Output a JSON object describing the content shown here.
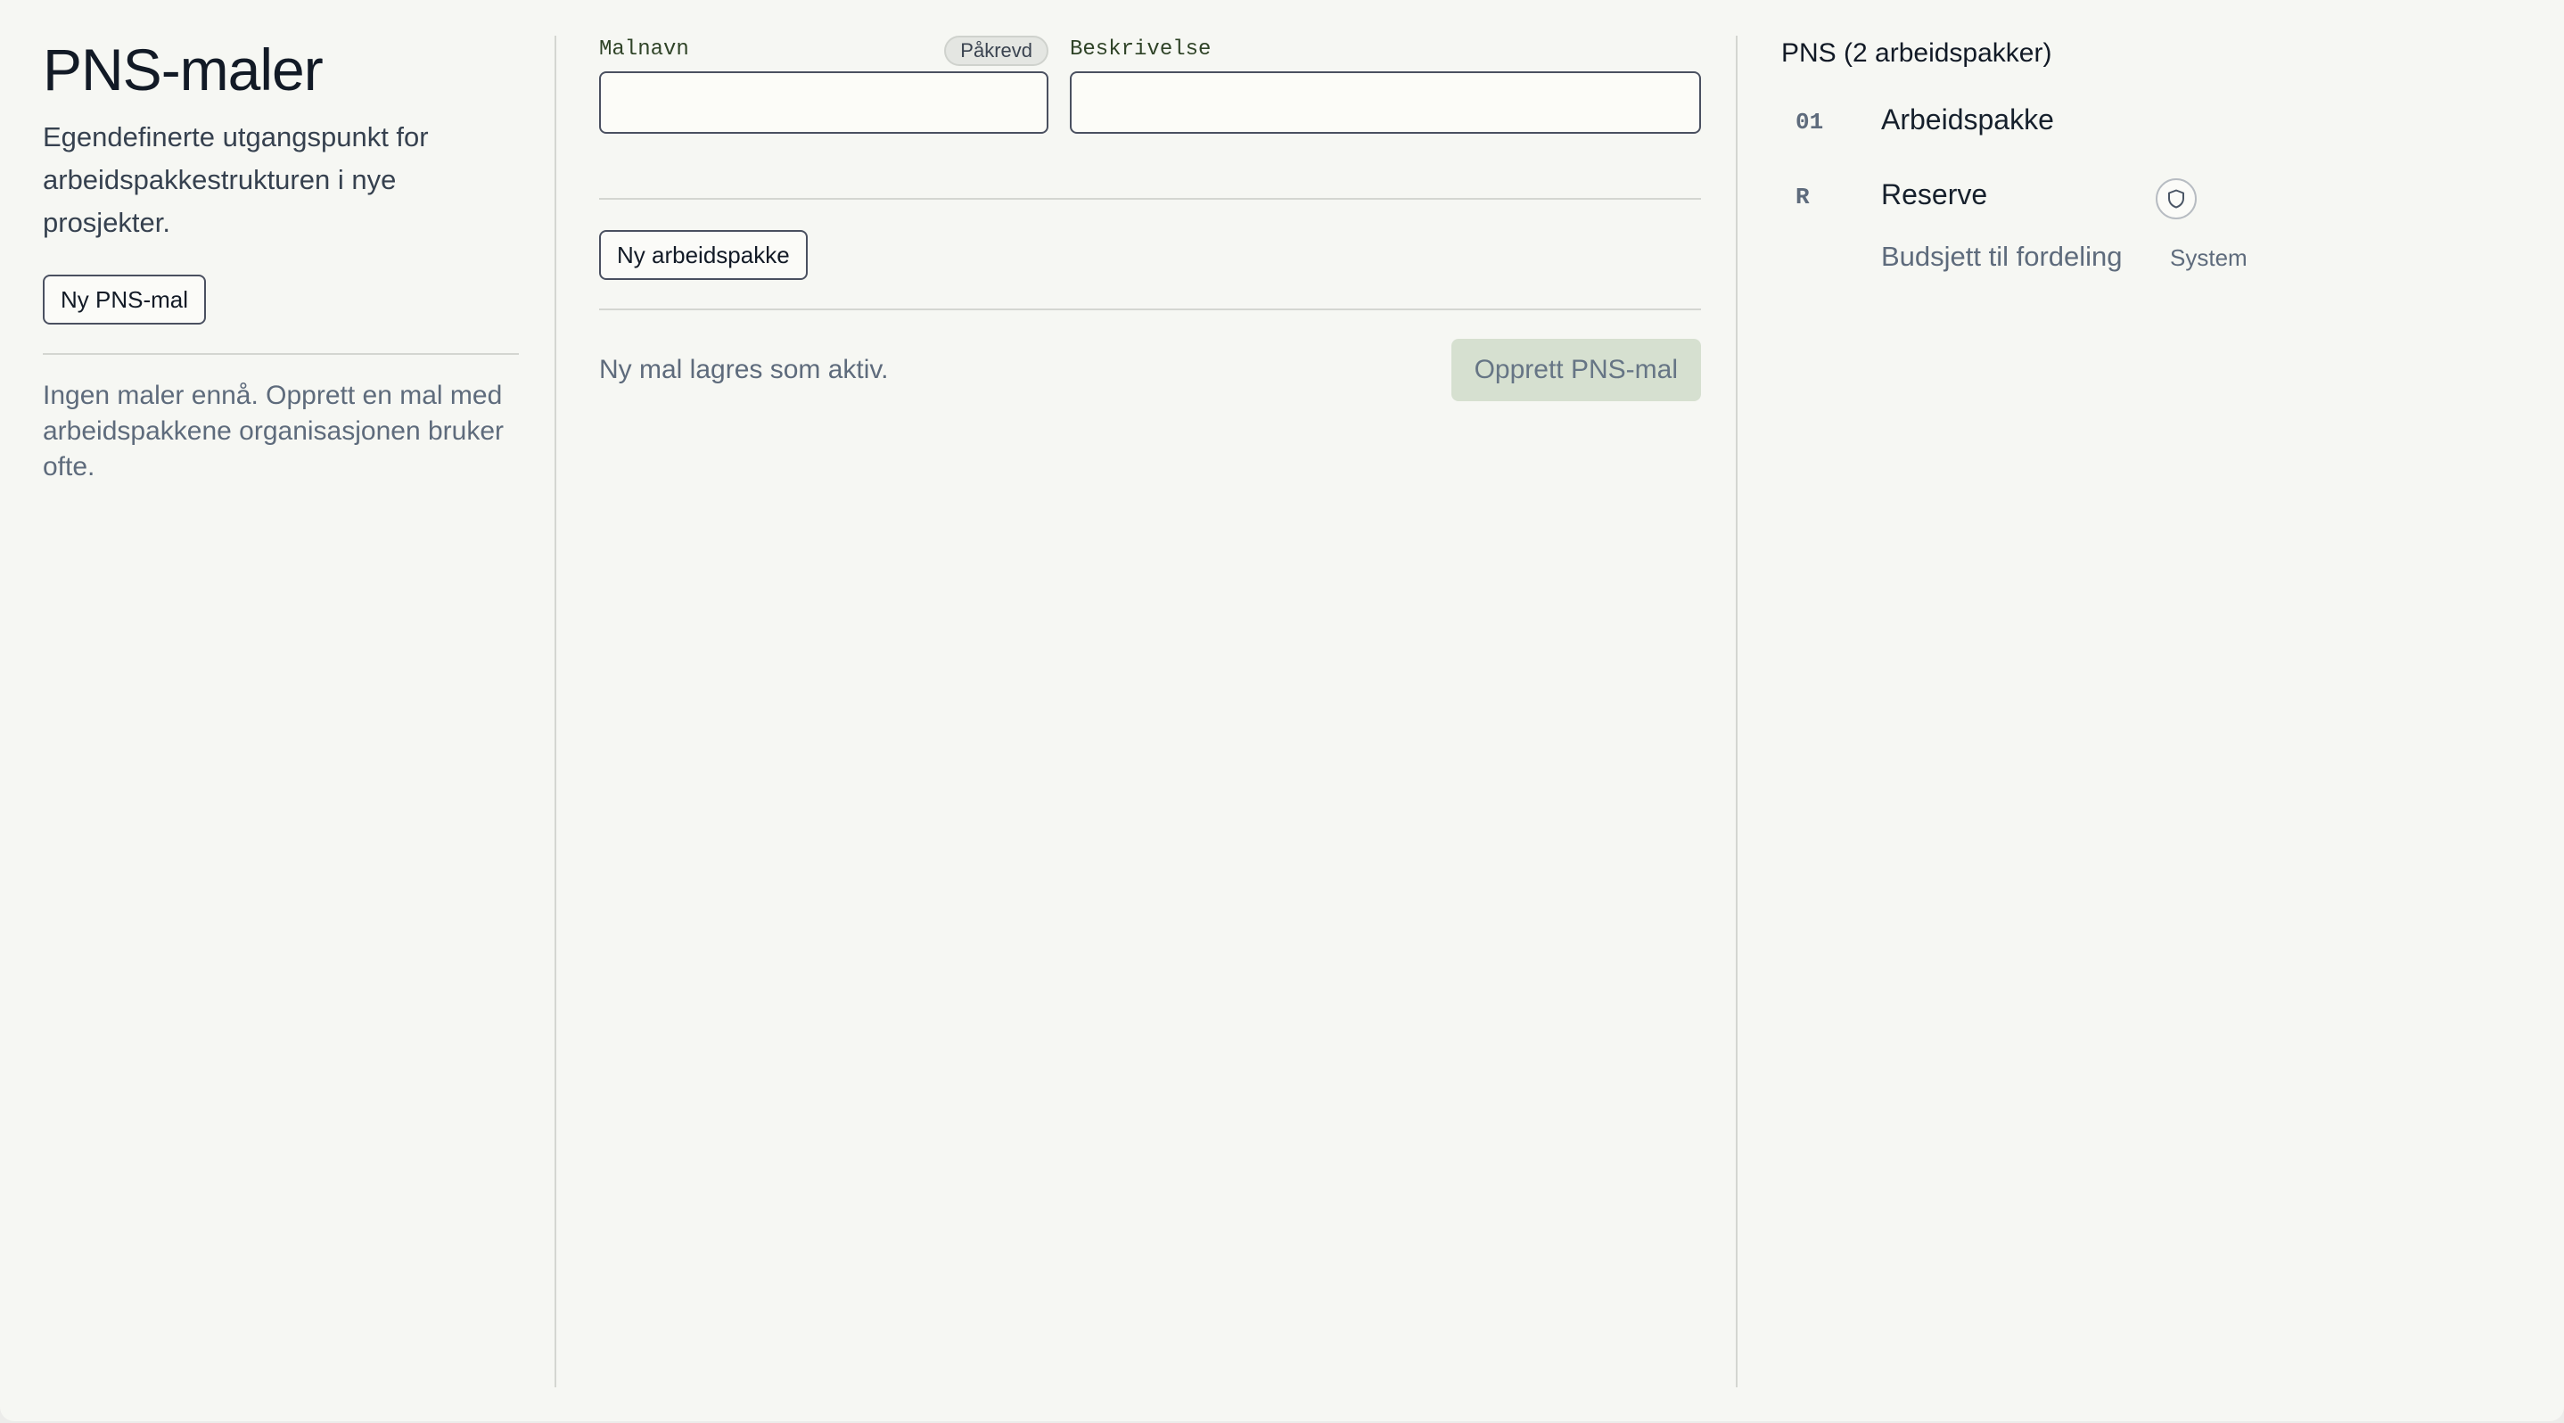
{
  "left": {
    "title": "PNS-maler",
    "subtitle": "Egendefinerte utgangspunkt for arbeidspakkestrukturen i nye prosjekter.",
    "new_template_label": "Ny PNS-mal",
    "empty_text": "Ingen maler ennå. Opprett en mal med arbeidspakkene organisasjonen bruker ofte."
  },
  "form": {
    "name_label": "Malnavn",
    "required_badge": "Påkrevd",
    "name_value": "",
    "description_label": "Beskrivelse",
    "description_value": "",
    "new_work_package_label": "Ny arbeidspakke",
    "footer_note": "Ny mal lagres som aktiv.",
    "create_label": "Opprett PNS-mal"
  },
  "preview": {
    "title": "PNS (2 arbeidspakker)",
    "items": [
      {
        "code": "01",
        "name": "Arbeidspakke"
      },
      {
        "code": "R",
        "name": "Reserve",
        "icon": "shield-icon"
      }
    ],
    "budget_label": "Budsjett til fordeling",
    "budget_tag": "System"
  },
  "colors": {
    "background": "#f6f7f3",
    "text": "#16202c",
    "muted": "#5e6b7c",
    "field_label": "#2f4327",
    "primary_disabled": "#d6e0d0",
    "divider": "#d4d6d1"
  }
}
